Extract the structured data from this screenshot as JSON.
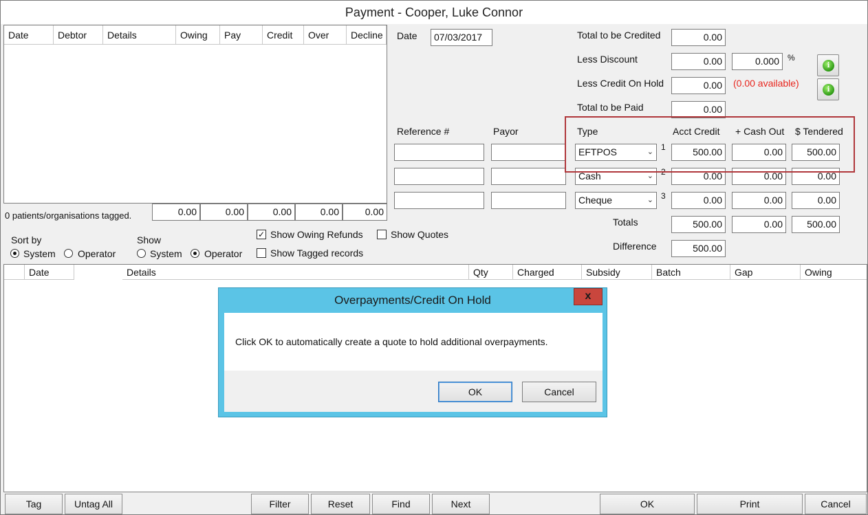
{
  "window": {
    "title": "Payment - Cooper, Luke Connor"
  },
  "debtor_table": {
    "columns": [
      "Date",
      "Debtor",
      "Details",
      "Owing",
      "Pay",
      "Credit",
      "Over",
      "Decline"
    ],
    "tagged_status": "0 patients/organisations tagged.",
    "totals": [
      "0.00",
      "0.00",
      "0.00",
      "0.00",
      "0.00"
    ]
  },
  "date": {
    "label": "Date",
    "value": "07/03/2017"
  },
  "summary": {
    "total_credited_label": "Total to be Credited",
    "total_credited": "0.00",
    "less_discount_label": "Less Discount",
    "less_discount": "0.00",
    "discount_pct": "0.000",
    "pct_sign": "%",
    "less_credit_label": "Less Credit On Hold",
    "less_credit": "0.00",
    "credit_available": "(0.00 available)",
    "total_paid_label": "Total to be Paid",
    "total_paid": "0.00"
  },
  "payments": {
    "headers": {
      "reference": "Reference #",
      "payor": "Payor",
      "type": "Type",
      "acct_credit": "Acct Credit",
      "cash_out": "+ Cash Out",
      "tendered": "$ Tendered"
    },
    "rows": [
      {
        "num": "1",
        "type": "EFTPOS",
        "acct_credit": "500.00",
        "cash_out": "0.00",
        "tendered": "500.00"
      },
      {
        "num": "2",
        "type": "Cash",
        "acct_credit": "0.00",
        "cash_out": "0.00",
        "tendered": "0.00"
      },
      {
        "num": "3",
        "type": "Cheque",
        "acct_credit": "0.00",
        "cash_out": "0.00",
        "tendered": "0.00"
      }
    ],
    "totals_label": "Totals",
    "totals": {
      "acct_credit": "500.00",
      "cash_out": "0.00",
      "tendered": "500.00"
    },
    "difference_label": "Difference",
    "difference": "500.00"
  },
  "options": {
    "sort_by_label": "Sort by",
    "show_label": "Show",
    "system": "System",
    "operator": "Operator",
    "show_owing_refunds": "Show Owing Refunds",
    "show_quotes": "Show Quotes",
    "show_tagged": "Show Tagged records"
  },
  "items_table": {
    "columns": [
      "Date",
      "Details",
      "Qty",
      "Charged",
      "Subsidy",
      "Batch",
      "Gap",
      "Owing"
    ]
  },
  "dialog": {
    "title": "Overpayments/Credit On Hold",
    "close": "x",
    "message": "Click OK to automatically create a quote to hold additional overpayments.",
    "ok": "OK",
    "cancel": "Cancel"
  },
  "buttons": {
    "tag": "Tag",
    "untag_all": "Untag All",
    "filter": "Filter",
    "reset": "Reset",
    "find": "Find",
    "next": "Next",
    "ok": "OK",
    "print": "Print",
    "cancel": "Cancel"
  },
  "colors": {
    "dialog_frame": "#5bc4e6",
    "highlight": "#b0363a",
    "available": "#e8261e",
    "close_button": "#c9463d"
  }
}
